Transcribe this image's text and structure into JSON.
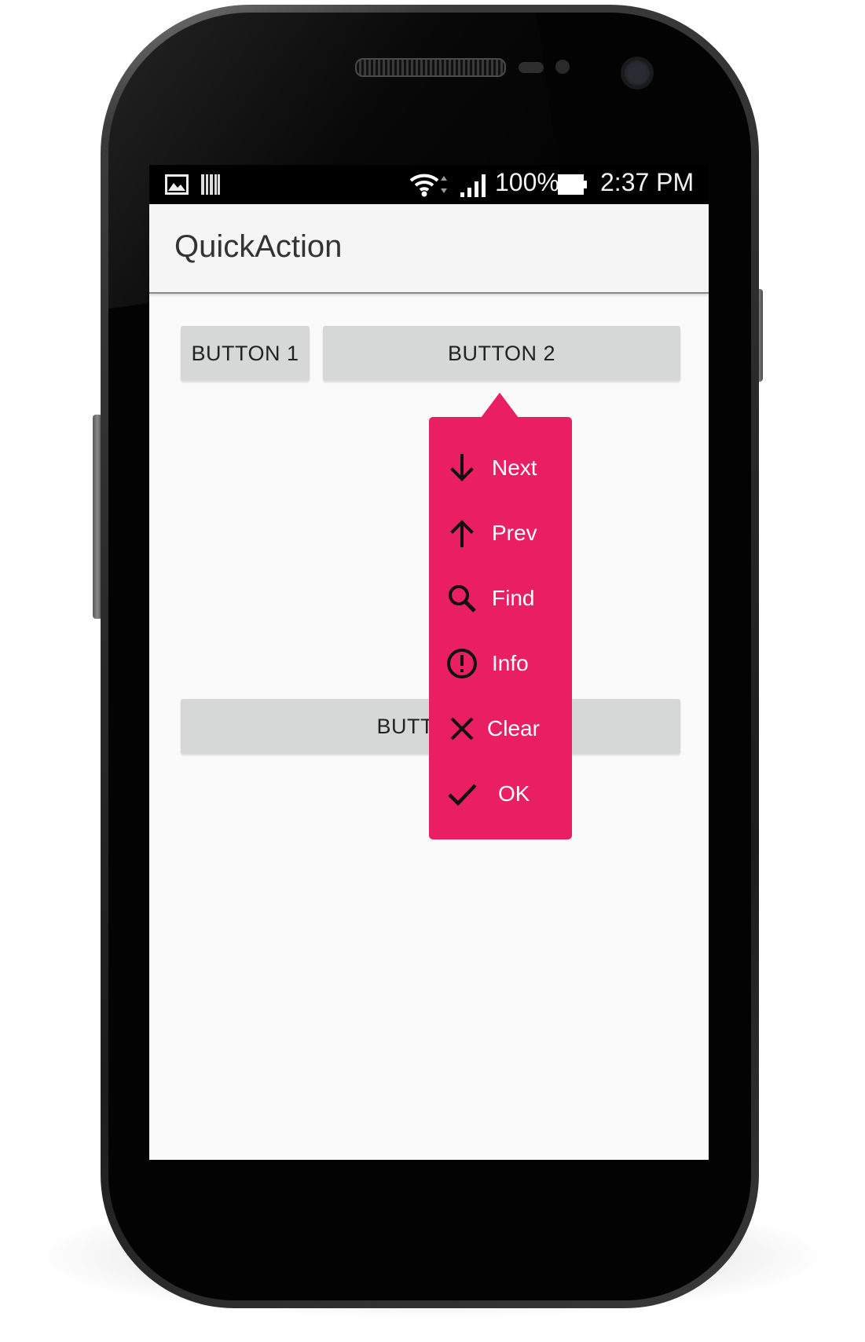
{
  "status_bar": {
    "battery": "100%",
    "time": "2:37 PM",
    "icons": [
      "gallery-icon",
      "barcode-icon",
      "wifi-icon",
      "signal-icon",
      "battery-icon"
    ]
  },
  "app_bar": {
    "title": "QuickAction"
  },
  "buttons": {
    "button1": "BUTTON 1",
    "button2": "BUTTON 2",
    "button3": "BUTTON 3"
  },
  "quick_action": {
    "color": "#e91e63",
    "items": [
      {
        "label": "Next",
        "icon": "arrow-down-icon"
      },
      {
        "label": "Prev",
        "icon": "arrow-up-icon"
      },
      {
        "label": "Find",
        "icon": "search-icon"
      },
      {
        "label": "Info",
        "icon": "info-icon"
      },
      {
        "label": "Clear",
        "icon": "close-icon"
      },
      {
        "label": "OK",
        "icon": "check-icon"
      }
    ]
  }
}
